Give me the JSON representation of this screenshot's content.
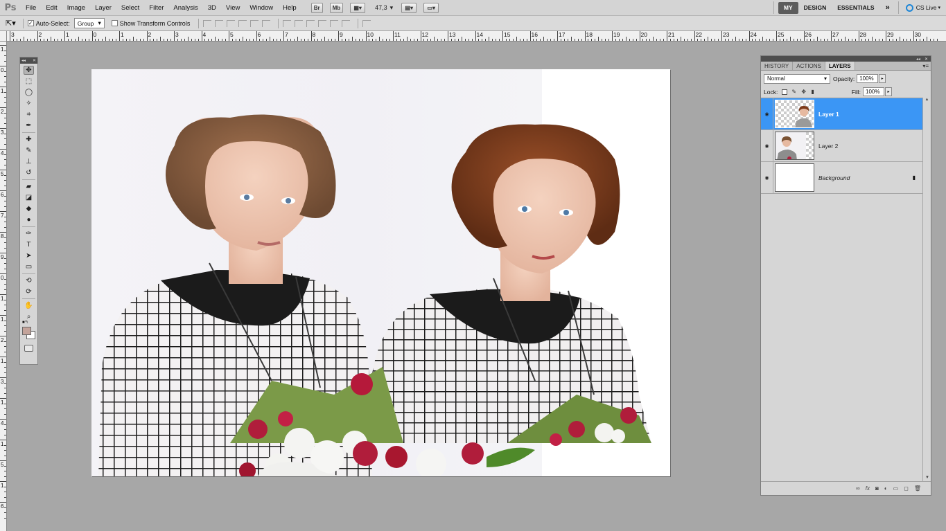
{
  "app": {
    "logo": "Ps",
    "menu": [
      "File",
      "Edit",
      "Image",
      "Layer",
      "Select",
      "Filter",
      "Analysis",
      "3D",
      "View",
      "Window",
      "Help"
    ],
    "bridge_btn": "Br",
    "minibridge_btn": "Mb",
    "zoom": "47,3",
    "workspaces": {
      "my": "MY",
      "design": "DESIGN",
      "essentials": "ESSENTIALS",
      "more": "»"
    },
    "cslive": "CS Live"
  },
  "options": {
    "auto_select_label": "Auto-Select:",
    "auto_select_checked": true,
    "auto_select_value": "Group",
    "show_transform_label": "Show Transform Controls",
    "show_transform_checked": false
  },
  "ruler": {
    "top_numbers": [
      "3",
      "2",
      "1",
      "0",
      "1",
      "2",
      "3",
      "4",
      "5",
      "6",
      "7",
      "8",
      "9",
      "10",
      "11",
      "12",
      "13",
      "14",
      "15",
      "16",
      "17",
      "18",
      "19",
      "20",
      "21",
      "22",
      "23",
      "24",
      "25",
      "26",
      "27",
      "28",
      "29",
      "30"
    ],
    "left_numbers": [
      "1",
      "0",
      "1",
      "2",
      "3",
      "4",
      "5",
      "6",
      "7",
      "8",
      "9",
      "0",
      "1",
      "1",
      "2",
      "1",
      "3",
      "1",
      "4",
      "1",
      "5",
      "1",
      "6"
    ]
  },
  "toolbox": {
    "tools": [
      "move-tool",
      "marquee-tool",
      "lasso-tool",
      "quick-selection-tool",
      "crop-tool",
      "eyedropper-tool",
      "spot-healing-tool",
      "brush-tool",
      "clone-stamp-tool",
      "history-brush-tool",
      "eraser-tool",
      "gradient-tool",
      "blur-tool",
      "dodge-tool",
      "pen-tool",
      "type-tool",
      "path-selection-tool",
      "rectangle-tool",
      "3d-rotate-tool",
      "3d-orbit-tool",
      "hand-tool",
      "zoom-tool"
    ],
    "foreground_color": "#c4a49b",
    "background_color": "#ffffff"
  },
  "panel": {
    "tabs": [
      "HISTORY",
      "ACTIONS",
      "LAYERS"
    ],
    "active_tab": "LAYERS",
    "blend_mode": "Normal",
    "opacity_label": "Opacity:",
    "opacity_value": "100%",
    "lock_label": "Lock:",
    "fill_label": "Fill:",
    "fill_value": "100%",
    "layers": [
      {
        "name": "Layer 1",
        "selected": true,
        "visible": true
      },
      {
        "name": "Layer 2",
        "selected": false,
        "visible": true
      },
      {
        "name": "Background",
        "selected": false,
        "visible": true,
        "locked": true
      }
    ]
  },
  "colors": {
    "selection_blue": "#3b96f5",
    "cslive_blue": "#1e86d6"
  }
}
